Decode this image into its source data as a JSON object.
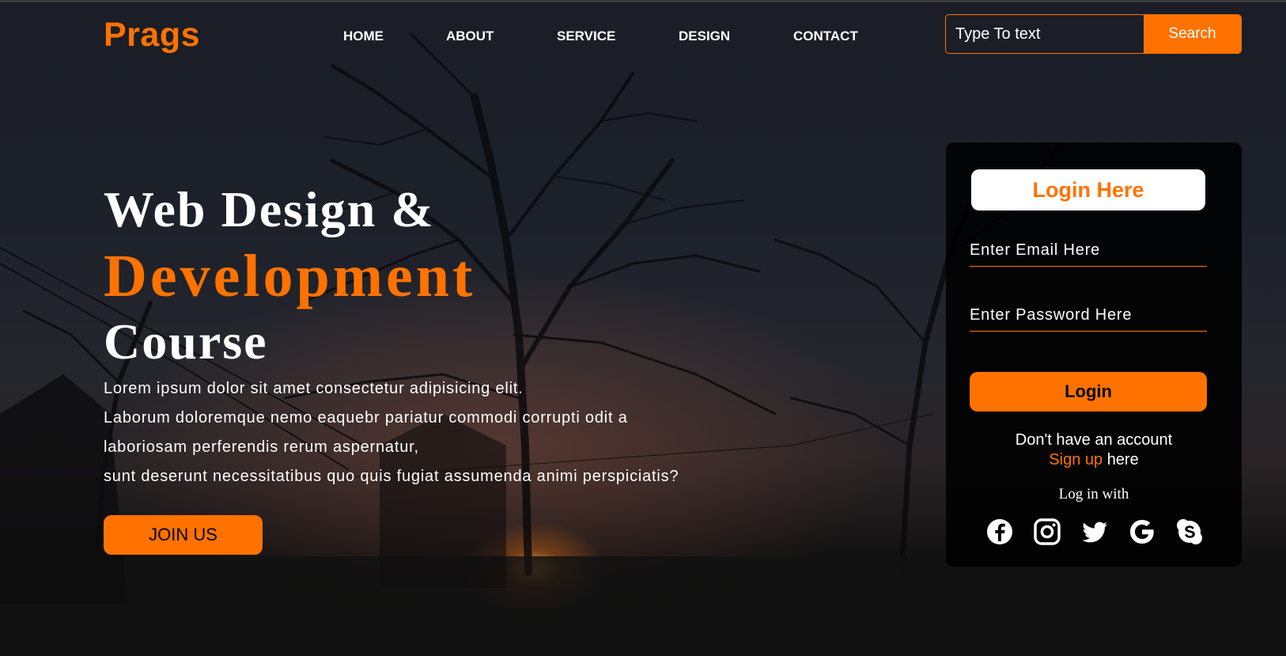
{
  "brand": "Prags",
  "nav": [
    {
      "label": "HOME"
    },
    {
      "label": "ABOUT"
    },
    {
      "label": "SERVICE"
    },
    {
      "label": "DESIGN"
    },
    {
      "label": "CONTACT"
    }
  ],
  "search": {
    "placeholder": "Type To text",
    "button_label": "Search"
  },
  "hero": {
    "line1": "Web Design &",
    "line2": "Development",
    "line3": "Course",
    "paragraph": [
      "Lorem ipsum dolor sit amet consectetur adipisicing elit.",
      "Laborum doloremque nemo eaquebr pariatur commodi corrupti odit a",
      "laboriosam perferendis rerum aspernatur,",
      "sunt deserunt necessitatibus quo quis fugiat assumenda animi perspiciatis?"
    ],
    "cta_label": "JOIN US"
  },
  "login": {
    "title": "Login Here",
    "email_placeholder": "Enter Email Here",
    "password_placeholder": "Enter Password Here",
    "button_label": "Login",
    "no_account_text": "Don't have an account",
    "signup_link": "Sign up",
    "signup_suffix": "here",
    "login_with": "Log in with",
    "socials": [
      "facebook-icon",
      "instagram-icon",
      "twitter-icon",
      "google-icon",
      "skype-icon"
    ]
  },
  "colors": {
    "accent": "#ff7200",
    "text": "#ffffff",
    "card_bg": "#000000",
    "page_bg": "#111214"
  }
}
